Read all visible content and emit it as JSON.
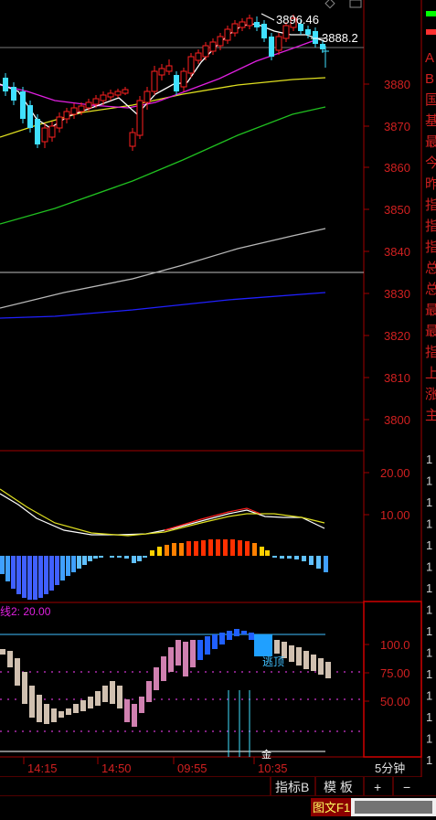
{
  "main_chart": {
    "high_label": "3896.46",
    "current_label": "3888.2",
    "price_ticks": [
      "3880",
      "3870",
      "3860",
      "3850",
      "3840",
      "3830",
      "3820",
      "3810",
      "3800"
    ]
  },
  "macd_chart": {
    "ticks": [
      "20.00",
      "10.00"
    ]
  },
  "indicator_chart": {
    "legend": "线2: 20.00",
    "ticks": [
      "100.0",
      "75.00",
      "50.00"
    ],
    "signal_text": "逃顶",
    "bottom_label": "金"
  },
  "time_axis": {
    "labels": [
      "14:15",
      "14:50",
      "09:55",
      "10:35"
    ],
    "period": "5分钟"
  },
  "toolbar": {
    "indicator_button": "指标B",
    "template_button": "模 板",
    "plus_button": "+",
    "minus_button": "−"
  },
  "side_panel": {
    "chars": [
      "A",
      "B",
      "国",
      "基",
      "最",
      "今",
      "昨",
      "指",
      "指",
      "指",
      "总",
      "总",
      "最",
      "最",
      "指",
      "上",
      "涨",
      "主"
    ],
    "colors": {
      "up": "#ff3030",
      "down": "#00ff00"
    }
  },
  "status_bar": {
    "text": "图文F1",
    "chars": [
      "1",
      "1",
      "1",
      "1",
      "1",
      "1",
      "1",
      "1",
      "1",
      "1",
      "1",
      "1",
      "1",
      "1",
      "1",
      "1",
      "1",
      "1",
      "1",
      "1",
      "1",
      "1",
      "1",
      "1",
      "1",
      "1"
    ]
  },
  "colors": {
    "grid_red": "#a00000",
    "axis_text": "#d02020",
    "up": "#ff2020",
    "down": "#40e0ff",
    "ma5": "#ffffff",
    "ma10": "#e020e0",
    "ma20": "#e0e020",
    "ma30": "#20c020",
    "ma60": "#b0b0b0",
    "ma120": "#2020ff"
  }
}
